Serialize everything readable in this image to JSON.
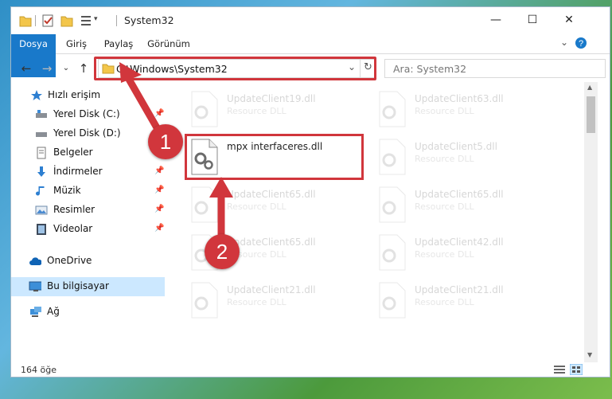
{
  "window": {
    "title": "System32"
  },
  "window_buttons": {
    "minimize": "—",
    "maximize": "☐",
    "close": "✕"
  },
  "ribbon": {
    "tabs": [
      "Dosya",
      "Giriş",
      "Paylaş",
      "Görünüm"
    ]
  },
  "nav": {
    "back": "←",
    "forward": "→",
    "recent": "⌄",
    "up": "↑"
  },
  "address": {
    "path": "C:\\Windows\\System32",
    "dropdown": "⌄",
    "refresh": "↻"
  },
  "search": {
    "placeholder": "Ara: System32"
  },
  "sidebar": {
    "items": [
      {
        "label": "Hızlı erişim",
        "icon": "star-icon"
      },
      {
        "label": "Yerel Disk (C:)",
        "icon": "drive-icon"
      },
      {
        "label": "Yerel Disk (D:)",
        "icon": "drive-icon"
      },
      {
        "label": "Belgeler",
        "icon": "documents-icon"
      },
      {
        "label": "İndirmeler",
        "icon": "download-icon"
      },
      {
        "label": "Müzik",
        "icon": "music-icon"
      },
      {
        "label": "Resimler",
        "icon": "pictures-icon"
      },
      {
        "label": "Videolar",
        "icon": "video-icon"
      },
      {
        "label": "OneDrive",
        "icon": "cloud-icon"
      },
      {
        "label": "Bu bilgisayar",
        "icon": "computer-icon"
      },
      {
        "label": "Ağ",
        "icon": "network-icon"
      }
    ]
  },
  "files": [
    {
      "name": "UpdateClient19.dll",
      "type": "Resource DLL"
    },
    {
      "name": "UpdateClient63.dll",
      "type": "Resource DLL"
    },
    {
      "name": "mpx interfaceres.dll",
      "type": ""
    },
    {
      "name": "UpdateClient5.dll",
      "type": "Resource DLL"
    },
    {
      "name": "UpdateClient65.dll",
      "type": "Resource DLL"
    },
    {
      "name": "UpdateClient65.dll",
      "type": "Resource DLL"
    },
    {
      "name": "UpdateClient65.dll",
      "type": "Resource DLL"
    },
    {
      "name": "UpdateClient42.dll",
      "type": "Resource DLL"
    },
    {
      "name": "UpdateClient21.dll",
      "type": "Resource DLL"
    },
    {
      "name": "UpdateClient21.dll",
      "type": "Resource DLL"
    }
  ],
  "status": {
    "count": "164 öğe"
  },
  "callouts": {
    "step1": "1",
    "step2": "2"
  },
  "colors": {
    "accent": "#1979ca",
    "highlight": "#d1363c",
    "selected": "#cce8ff"
  }
}
